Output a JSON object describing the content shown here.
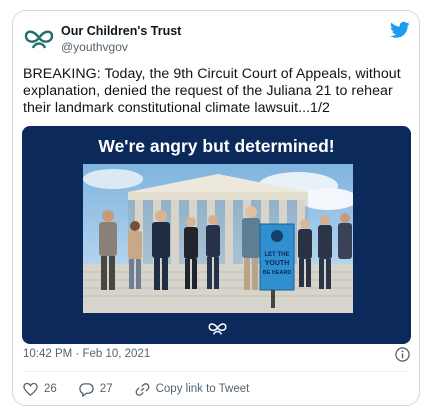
{
  "tweet": {
    "author_name": "Our Children's Trust",
    "author_handle": "@youthvgov",
    "text": "BREAKING: Today, the 9th Circuit Court of Appeals, without explanation, denied the request of the Juliana 21 to rehear their landmark constitutional climate lawsuit...1/2",
    "timestamp": "10:42 PM · Feb 10, 2021"
  },
  "media": {
    "headline": "We're angry but determined!",
    "banner_lines": [
      "LET THE",
      "YOUTH",
      "BE HEARD"
    ],
    "background_color": "#0b2a5b"
  },
  "actions": {
    "like_count": "26",
    "reply_count": "27",
    "copy_label": "Copy link to Tweet"
  },
  "colors": {
    "brand_blue": "#1d9bf0",
    "text": "#0f1419",
    "secondary": "#536471"
  },
  "icons": [
    "logo-icon",
    "twitter-bird-icon",
    "info-icon",
    "heart-icon",
    "reply-icon",
    "link-icon"
  ]
}
